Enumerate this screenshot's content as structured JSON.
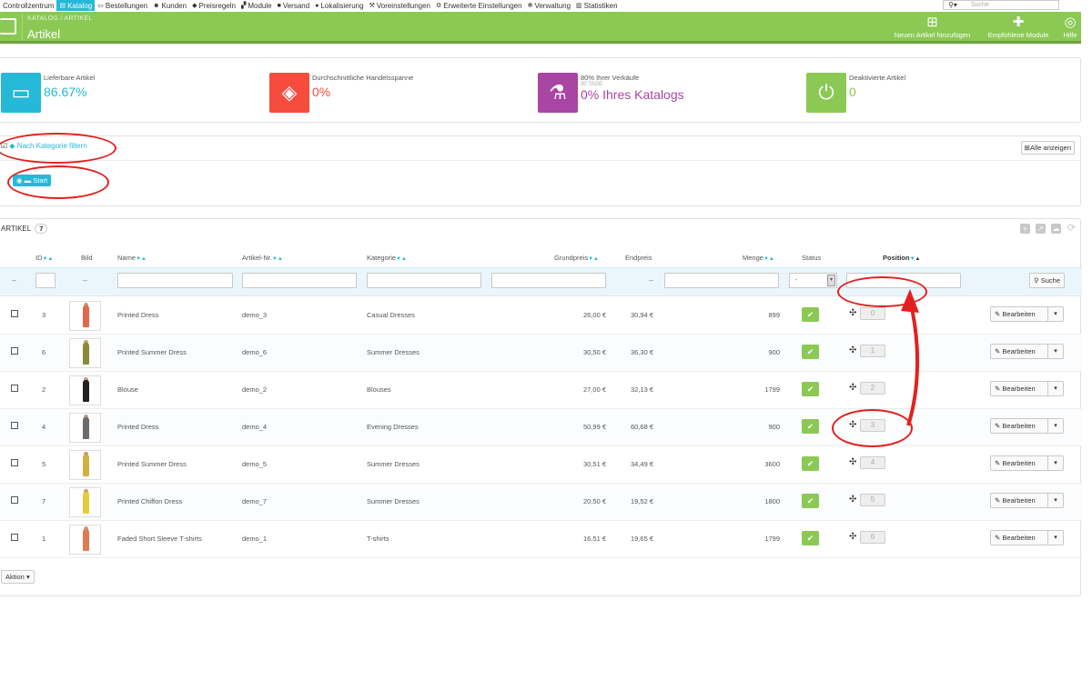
{
  "nav": {
    "items": [
      {
        "label": "Controllzentrum",
        "icon": ""
      },
      {
        "label": "Katalog",
        "icon": "katalog-icon",
        "active": true
      },
      {
        "label": "Bestellungen",
        "icon": "cart-icon"
      },
      {
        "label": "Kunden",
        "icon": "users-icon"
      },
      {
        "label": "Preisregeln",
        "icon": "tags-icon"
      },
      {
        "label": "Module",
        "icon": "puzzle-icon"
      },
      {
        "label": "Versand",
        "icon": "truck-icon"
      },
      {
        "label": "Lokalisierung",
        "icon": "globe-icon"
      },
      {
        "label": "Voreinstellungen",
        "icon": "wrench-icon"
      },
      {
        "label": "Erweiterte Einstellungen",
        "icon": "cogs-icon"
      },
      {
        "label": "Verwaltung",
        "icon": "gear-icon"
      },
      {
        "label": "Statistiken",
        "icon": "chart-icon"
      }
    ],
    "search_placeholder": "Suche"
  },
  "header": {
    "breadcrumb": "KATALOG  /  ARTIKEL",
    "title": "Artikel",
    "buttons": {
      "new": "Neuen Artikel hinzufügen",
      "recommended": "Empfohlene Module",
      "help": "Hilfe"
    }
  },
  "kpis": [
    {
      "label": "Lieferbare Artikel",
      "sublabel": "",
      "value": "86.67%",
      "color": "#25b9d7"
    },
    {
      "label": "Durchschnittliche Handelsspanne",
      "sublabel": "",
      "value": "0%",
      "color": "#f54c3e"
    },
    {
      "label": "80% Ihrer Verkäufe",
      "sublabel": "30 TAGE",
      "value": "0% Ihres Katalogs",
      "color": "#a945a3"
    },
    {
      "label": "Deaktivierte Artikel",
      "sublabel": "",
      "value": "0",
      "color": "#8bc954"
    }
  ],
  "category_filter": {
    "toggle": "Nach Kategorie filtern",
    "show_all": "Alle anzeigen",
    "root": "Start"
  },
  "list": {
    "title": "ARTIKEL",
    "count": "7",
    "columns": {
      "id": "ID",
      "image": "Bild",
      "name": "Name",
      "reference": "Artikel-Nr.",
      "category": "Kategorie",
      "base_price": "Grundpreis",
      "final_price": "Endpreis",
      "quantity": "Menge",
      "status": "Status",
      "position": "Position"
    },
    "filters": {
      "dash": "--",
      "status_select": "-",
      "search_button": "Suche"
    },
    "rows": [
      {
        "id": "3",
        "name": "Printed Dress",
        "ref": "demo_3",
        "category": "Casual Dresses",
        "base": "26,00 €",
        "final": "30,94 €",
        "qty": "899",
        "pos": "0",
        "color": "#e0684c"
      },
      {
        "id": "6",
        "name": "Printed Summer Dress",
        "ref": "demo_6",
        "category": "Summer Dresses",
        "base": "30,50 €",
        "final": "36,30 €",
        "qty": "900",
        "pos": "1",
        "color": "#8a8a3a"
      },
      {
        "id": "2",
        "name": "Blouse",
        "ref": "demo_2",
        "category": "Blouses",
        "base": "27,00 €",
        "final": "32,13 €",
        "qty": "1799",
        "pos": "2",
        "color": "#222222"
      },
      {
        "id": "4",
        "name": "Printed Dress",
        "ref": "demo_4",
        "category": "Evening Dresses",
        "base": "50,99 €",
        "final": "60,68 €",
        "qty": "900",
        "pos": "3",
        "color": "#6b6b6b"
      },
      {
        "id": "5",
        "name": "Printed Summer Dress",
        "ref": "demo_5",
        "category": "Summer Dresses",
        "base": "30,51 €",
        "final": "34,49 €",
        "qty": "3600",
        "pos": "4",
        "color": "#d3b140"
      },
      {
        "id": "7",
        "name": "Printed Chiffon Dress",
        "ref": "demo_7",
        "category": "Summer Dresses",
        "base": "20,50 €",
        "final": "19,52 €",
        "qty": "1800",
        "pos": "5",
        "color": "#e2cc3a"
      },
      {
        "id": "1",
        "name": "Faded Short Sleeve T-shirts",
        "ref": "demo_1",
        "category": "T-shirts",
        "base": "16,51 €",
        "final": "19,65 €",
        "qty": "1799",
        "pos": "6",
        "color": "#e07a50"
      }
    ],
    "edit_label": "Bearbeiten",
    "bulk_action": "Aktion"
  }
}
